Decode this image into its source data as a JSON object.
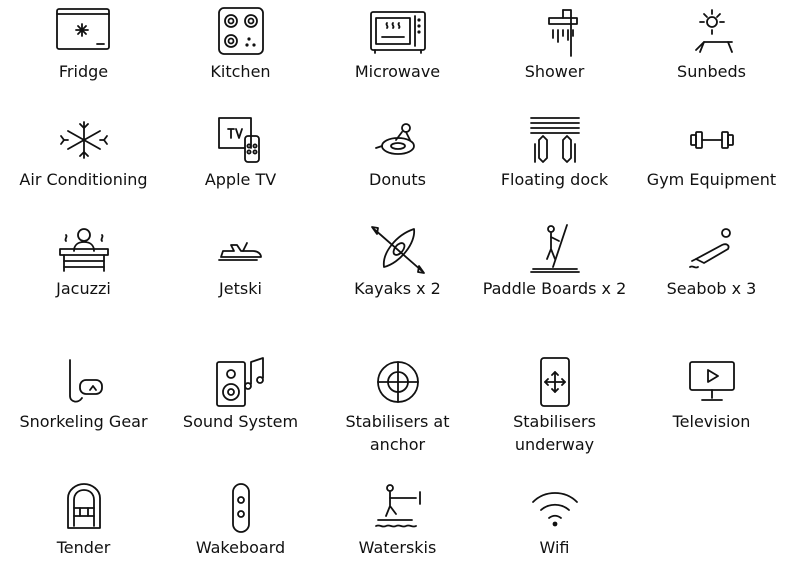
{
  "amenities": [
    {
      "label": "Fridge",
      "icon": "fridge-icon"
    },
    {
      "label": "Kitchen",
      "icon": "kitchen-icon"
    },
    {
      "label": "Microwave",
      "icon": "microwave-icon"
    },
    {
      "label": "Shower",
      "icon": "shower-icon"
    },
    {
      "label": "Sunbeds",
      "icon": "sunbed-icon"
    },
    {
      "label": "Air Conditioning",
      "icon": "air-conditioning-icon"
    },
    {
      "label": "Apple TV",
      "icon": "apple-tv-icon"
    },
    {
      "label": "Donuts",
      "icon": "donut-ride-icon"
    },
    {
      "label": "Floating dock",
      "icon": "floating-dock-icon"
    },
    {
      "label": "Gym Equipment",
      "icon": "dumbbell-icon"
    },
    {
      "label": "Jacuzzi",
      "icon": "jacuzzi-icon"
    },
    {
      "label": "Jetski",
      "icon": "jetski-icon"
    },
    {
      "label": "Kayaks x 2",
      "icon": "kayak-icon"
    },
    {
      "label": "Paddle Boards x 2",
      "icon": "paddle-board-icon"
    },
    {
      "label": "Seabob x 3",
      "icon": "seabob-icon"
    },
    {
      "label": "Snorkeling Gear",
      "icon": "snorkel-icon"
    },
    {
      "label": "Sound System",
      "icon": "speaker-icon"
    },
    {
      "label": "Stabilisers at anchor",
      "icon": "stabiliser-anchor-icon"
    },
    {
      "label": "Stabilisers underway",
      "icon": "stabiliser-underway-icon"
    },
    {
      "label": "Television",
      "icon": "television-icon"
    },
    {
      "label": "Tender",
      "icon": "tender-boat-icon"
    },
    {
      "label": "Wakeboard",
      "icon": "wakeboard-icon"
    },
    {
      "label": "Waterskis",
      "icon": "waterski-icon"
    },
    {
      "label": "Wifi",
      "icon": "wifi-icon"
    }
  ]
}
